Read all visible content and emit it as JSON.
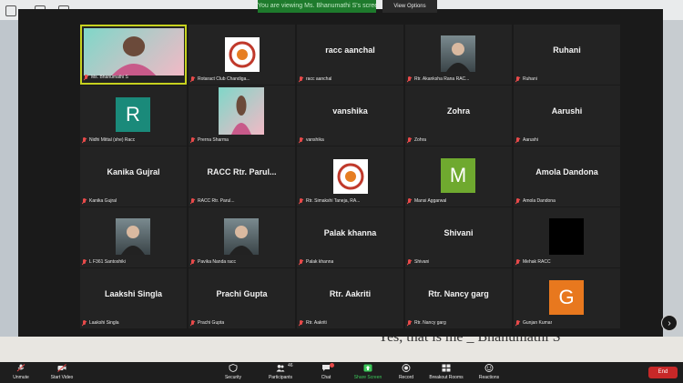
{
  "window": {
    "talking_banner": "You are viewing Ms. Bhanumathi S's screen",
    "view_options": "View Options"
  },
  "desktop": {
    "caption": "Yes, that is me _ Bhanumathi S"
  },
  "participants": [
    {
      "name": "Ms. Bhanumathi S",
      "display": "video",
      "active": true
    },
    {
      "name": "Rotaract Club Chandiga...",
      "display": "logo"
    },
    {
      "name": "racc aanchal",
      "display": "text"
    },
    {
      "name": "Rtr. Akanksha Rana RAC...",
      "display": "photo"
    },
    {
      "name": "Ruhani",
      "display": "text"
    },
    {
      "name": "Nidhi Mittal (she) Racc",
      "display": "avatar",
      "letter": "R",
      "color": "#1a8a7a"
    },
    {
      "name": "Prerna Sharma",
      "display": "video"
    },
    {
      "name": "vanshika",
      "display": "text"
    },
    {
      "name": "Zohra",
      "display": "text"
    },
    {
      "name": "Aarushi",
      "display": "text"
    },
    {
      "name": "Kanika Gujral",
      "display": "text"
    },
    {
      "name": "RACC Rtr. Parul...",
      "display": "text"
    },
    {
      "name": "Rtr. Simakshi Taneja, RA...",
      "display": "logo"
    },
    {
      "name": "Mansi Aggarwal",
      "display": "avatar",
      "letter": "M",
      "color": "#6fa92f"
    },
    {
      "name": "Amola Dandona",
      "display": "text"
    },
    {
      "name": "L F361 Santoshiki",
      "display": "photo"
    },
    {
      "name": "Pavika Nanda racc",
      "display": "photo"
    },
    {
      "name": "Palak khanna",
      "display": "text"
    },
    {
      "name": "Shivani",
      "display": "text"
    },
    {
      "name": "Mehak RACC",
      "display": "black"
    },
    {
      "name": "Laakshi Singla",
      "display": "text"
    },
    {
      "name": "Prachi Gupta",
      "display": "text"
    },
    {
      "name": "Rtr. Aakriti",
      "display": "text"
    },
    {
      "name": "Rtr. Nancy garg",
      "display": "text"
    },
    {
      "name": "Gunjan Kumar",
      "display": "avatar",
      "letter": "G",
      "color": "#e8781e"
    }
  ],
  "toolbar": {
    "unmute": "Unmute",
    "start_video": "Start Video",
    "security": "Security",
    "participants": "Participants",
    "participants_count": "46",
    "chat": "Chat",
    "share_screen": "Share Screen",
    "record": "Record",
    "breakout_rooms": "Breakout Rooms",
    "reactions": "Reactions",
    "end": "End"
  },
  "colors": {
    "active_speaker_border": "#c7d21f",
    "share_screen_green": "#3cc85a",
    "end_red": "#c72828",
    "muted_red": "#e84a4a"
  }
}
